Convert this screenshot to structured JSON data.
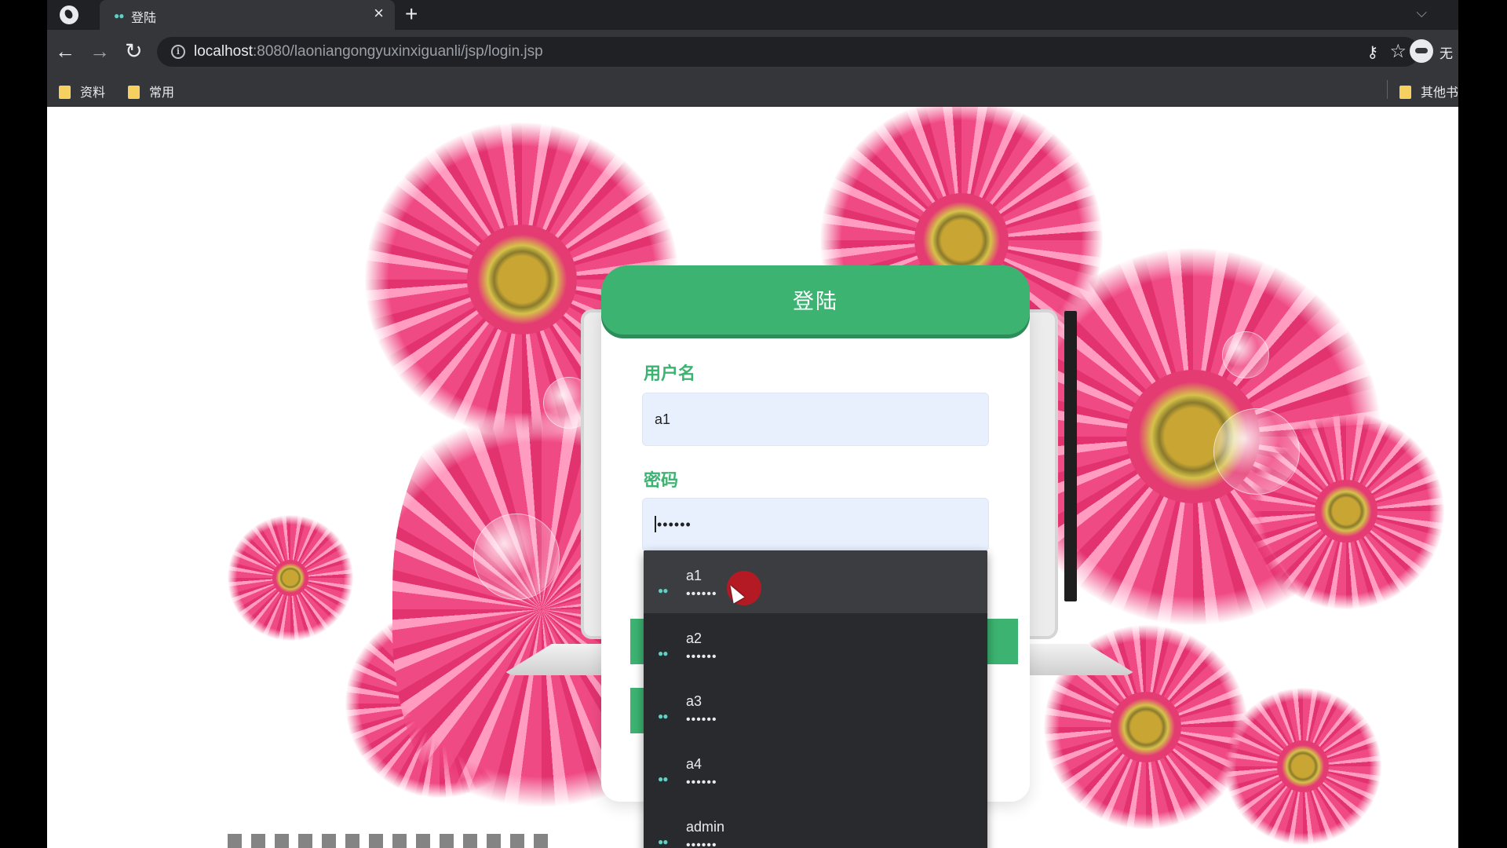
{
  "browser": {
    "tab": {
      "title": "登陆",
      "close_symbol": "×"
    },
    "new_tab_symbol": "+",
    "tab_search_symbol": "⌵",
    "url": {
      "host": "localhost",
      "rest": ":8080/laoniangongyuxinxiguanli/jsp/login.jsp"
    },
    "profile_label": "无",
    "bookmarks": [
      "资料",
      "常用"
    ],
    "other_bookmarks": "其他书"
  },
  "login": {
    "title": "登陆",
    "username_label": "用户名",
    "username_value": "a1",
    "password_label": "密码",
    "password_value": "••••••"
  },
  "autofill": {
    "entries": [
      {
        "user": "a1",
        "pass": "••••••"
      },
      {
        "user": "a2",
        "pass": "••••••"
      },
      {
        "user": "a3",
        "pass": "••••••"
      },
      {
        "user": "a4",
        "pass": "••••••"
      },
      {
        "user": "admin",
        "pass": "••••••"
      }
    ]
  },
  "colors": {
    "accent": "#3cb371",
    "chrome_dark": "#202124",
    "chrome_mid": "#35363a",
    "input_bg": "#e8f0fe"
  }
}
